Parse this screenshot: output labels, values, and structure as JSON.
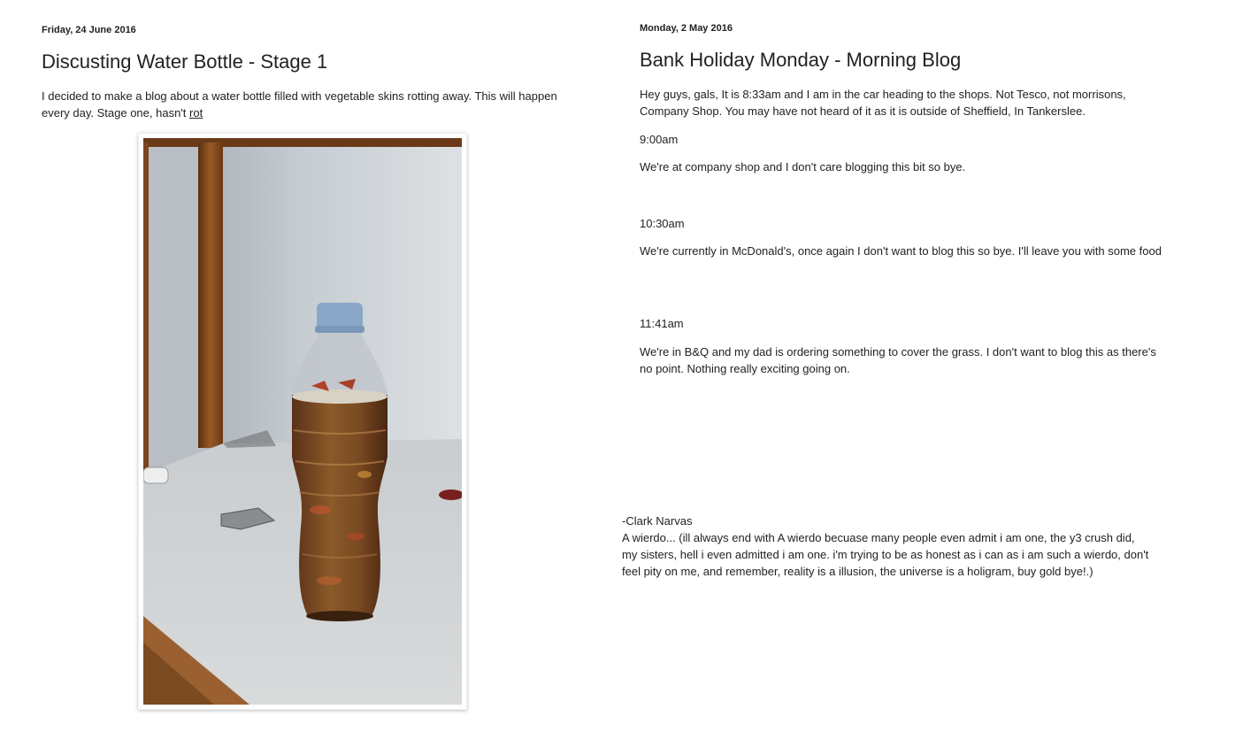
{
  "left_post": {
    "date": "Friday, 24 June 2016",
    "title": "Discusting Water Bottle - Stage 1",
    "intro_text": "I decided to make a blog about a water bottle filled with vegetable skins rotting away. This will happen every day. Stage one, hasn't ",
    "rot_link": "rot",
    "photo": {
      "icon": "water-bottle-photo"
    }
  },
  "right_post": {
    "date": "Monday, 2 May 2016",
    "title": "Bank Holiday Monday - Morning Blog",
    "paragraph_1": "Hey guys, gals, It is 8:33am and I am in the car heading to the shops. Not Tesco, not morrisons, Company Shop. You may have not heard of it as it is outside of Sheffield, In Tankerslee.",
    "time_1": "9:00am",
    "paragraph_2": "We're at company shop and I don't care blogging this bit so bye.",
    "time_2": "10:30am",
    "paragraph_3": "We're currently in McDonald's, once again I don't want to blog this so bye. I'll leave you with some food",
    "time_3": "11:41am",
    "paragraph_4": "We're in B&Q and my dad is ordering something to cover the grass. I don't want to blog this as there's no point. Nothing really exciting going on."
  },
  "signature": {
    "name": "-Clark Narvas",
    "text": "A wierdo... (ill always end with A wierdo becuase many people even admit i am one, the y3 crush did, my sisters, hell i even admitted i am one. i'm trying to be as honest as i can as i am such a wierdo, don't feel pity on me, and remember, reality is a illusion, the universe is a holigram, buy gold bye!.)"
  },
  "colors": {
    "text": "#222222",
    "background": "#ffffff"
  }
}
